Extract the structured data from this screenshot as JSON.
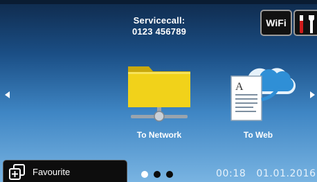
{
  "header": {
    "service_line1": "Servicecall:",
    "service_line2": "0123 456789",
    "wifi_label": "WiFi"
  },
  "tiles": [
    {
      "label": "To Network",
      "icon": "network-folder-icon"
    },
    {
      "label": "To Web",
      "icon": "web-document-cloud-icon"
    }
  ],
  "favourite": {
    "label": "Favourite",
    "icon": "favourite-add-icon"
  },
  "pagination": {
    "current": 1,
    "total": 3
  },
  "status": {
    "time": "00:18",
    "date": "01.01.2016"
  },
  "colors": {
    "folder": "#f1d21a",
    "cloud": "#2f8fd6",
    "accent_red": "#d01b1b"
  }
}
